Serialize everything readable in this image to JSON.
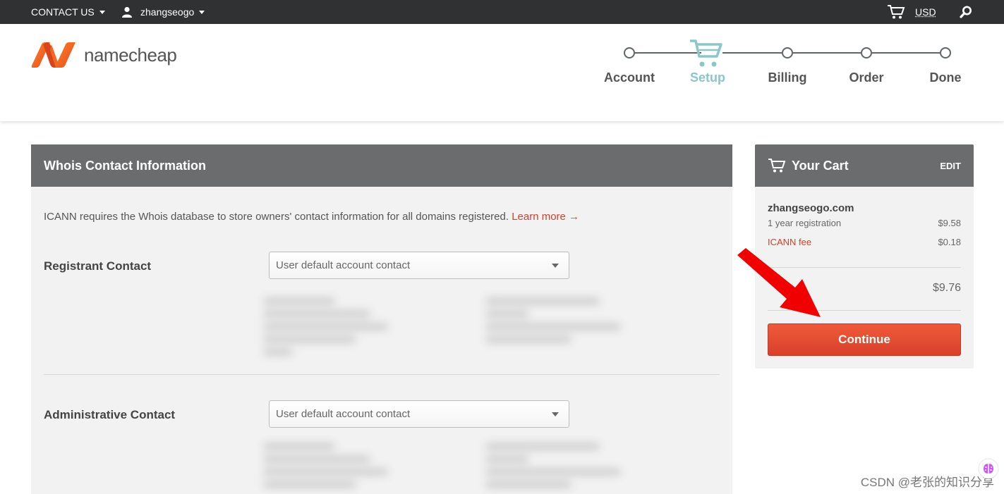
{
  "topbar": {
    "contact_label": "CONTACT US",
    "username": "zhangseogo",
    "currency": "USD",
    "icons": [
      "user-icon",
      "cart-icon",
      "search-icon"
    ]
  },
  "brand": {
    "name": "namecheap",
    "accent": "#ee5a24"
  },
  "steps": [
    {
      "label": "Account",
      "state": "done"
    },
    {
      "label": "Setup",
      "state": "active"
    },
    {
      "label": "Billing",
      "state": "todo"
    },
    {
      "label": "Order",
      "state": "todo"
    },
    {
      "label": "Done",
      "state": "todo"
    }
  ],
  "whois": {
    "title": "Whois Contact Information",
    "intro": "ICANN requires the Whois database to store owners' contact information for all domains registered.",
    "learn_more": "Learn more →",
    "registrant_label": "Registrant Contact",
    "registrant_value": "User default account contact",
    "admin_label": "Administrative Contact",
    "admin_value": "User default account contact"
  },
  "cart": {
    "title": "Your Cart",
    "edit_label": "EDIT",
    "domain": "zhangseogo.com",
    "items": [
      {
        "label": "1 year registration",
        "price": "$9.58"
      },
      {
        "label": "ICANN fee",
        "price": "$0.18"
      }
    ],
    "total": "$9.76",
    "continue_label": "Continue"
  },
  "watermark": "CSDN @老张的知识分享",
  "colors": {
    "topbar_bg": "#2f3133",
    "panel_header": "#6b6c6e",
    "panel_bg": "#f2f2f2",
    "active_step": "#8bc6c9",
    "button_red": "#e14b30"
  }
}
